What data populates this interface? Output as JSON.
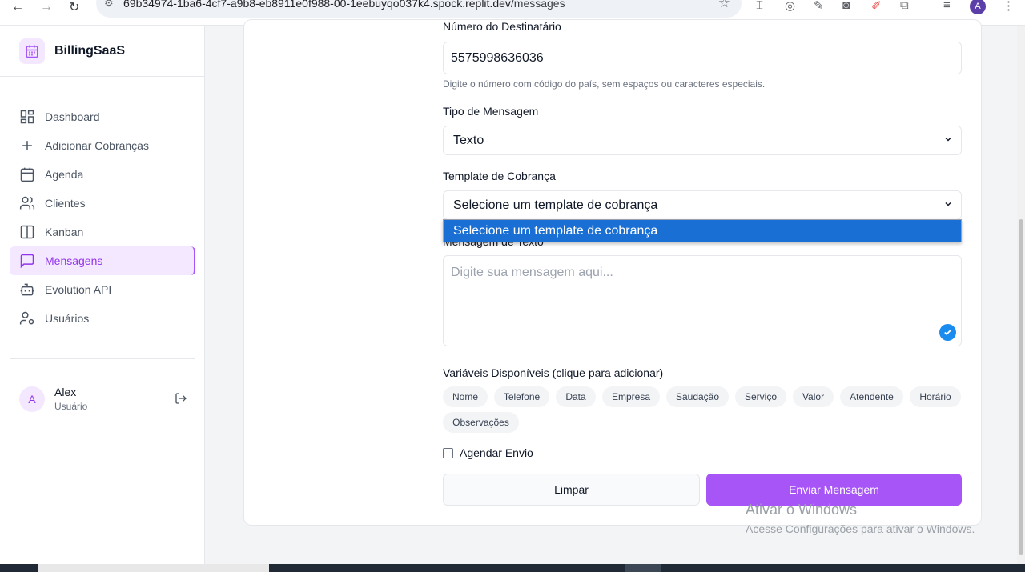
{
  "browser": {
    "url_host": "69b34974-1ba6-4cf7-a9b8-eb8911e0f988-00-1eebuyqo037k4.spock.replit.dev",
    "url_path": "/messages",
    "profile_initial": "A"
  },
  "sidebar": {
    "brand": "BillingSaaS",
    "items": [
      {
        "label": "Dashboard",
        "icon": "dashboard-icon"
      },
      {
        "label": "Adicionar Cobranças",
        "icon": "plus-icon"
      },
      {
        "label": "Agenda",
        "icon": "calendar-icon"
      },
      {
        "label": "Clientes",
        "icon": "users-icon"
      },
      {
        "label": "Kanban",
        "icon": "kanban-icon"
      },
      {
        "label": "Mensagens",
        "icon": "message-icon",
        "active": true
      },
      {
        "label": "Evolution API",
        "icon": "bot-icon"
      },
      {
        "label": "Usuários",
        "icon": "user-cog-icon"
      }
    ],
    "user": {
      "initial": "A",
      "name": "Alex",
      "role": "Usuário"
    }
  },
  "form": {
    "recipient_label": "Número do Destinatário",
    "recipient_value": "5575998636036",
    "recipient_help": "Digite o número com código do país, sem espaços ou caracteres especiais.",
    "type_label": "Tipo de Mensagem",
    "type_value": "Texto",
    "template_label": "Template de Cobrança",
    "template_value": "Selecione um template de cobrança",
    "template_option_highlighted": "Selecione um template de cobrança",
    "message_label": "Mensagem de Texto",
    "message_placeholder": "Digite sua mensagem aqui...",
    "variables_label": "Variáveis Disponíveis (clique para adicionar)",
    "variables": [
      "Nome",
      "Telefone",
      "Data",
      "Empresa",
      "Saudação",
      "Serviço",
      "Valor",
      "Atendente",
      "Horário",
      "Observações"
    ],
    "schedule_label": "Agendar Envio",
    "clear_button": "Limpar",
    "send_button": "Enviar Mensagem"
  },
  "watermark": {
    "line1": "Ativar o Windows",
    "line2": "Acesse Configurações para ativar o Windows."
  },
  "colors": {
    "accent": "#a855f7",
    "accent_light": "#f3e8ff",
    "dropdown_highlight": "#1a6fd4"
  }
}
